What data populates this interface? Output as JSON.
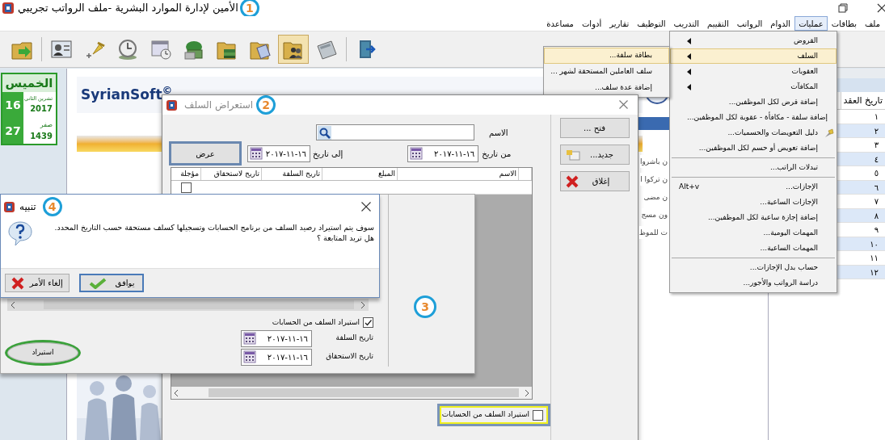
{
  "window": {
    "title": "الأمين لإدارة الموارد البشرية -ملف الرواتب تجريبي",
    "annotation": "1"
  },
  "menu_bar": [
    {
      "label": "ملف",
      "selected": false
    },
    {
      "label": "بطاقات",
      "selected": false
    },
    {
      "label": "عمليات",
      "selected": true
    },
    {
      "label": "الدوام",
      "selected": false
    },
    {
      "label": "الرواتب",
      "selected": false
    },
    {
      "label": "التقييم",
      "selected": false
    },
    {
      "label": "التدريب",
      "selected": false
    },
    {
      "label": "التوظيف",
      "selected": false
    },
    {
      "label": "تقارير",
      "selected": false
    },
    {
      "label": "أدوات",
      "selected": false
    },
    {
      "label": "مساعدة",
      "selected": false
    }
  ],
  "toolbar": [
    {
      "selected": false
    },
    {
      "selected": false
    },
    {
      "selected": false
    },
    {
      "selected": false
    },
    {
      "selected": false
    },
    {
      "selected": false
    },
    {
      "selected": false
    },
    {
      "selected": false
    },
    {
      "selected": true
    },
    {
      "selected": false
    },
    {
      "selected": false
    }
  ],
  "calendar": {
    "weekday": "الخميس",
    "day": "16",
    "month": "تشرين الثاني",
    "year": "2017",
    "hijri_day": "27",
    "hijri_month": "صفر",
    "hijri_year": "1439"
  },
  "main": {
    "logo": "SyrianSoft$^{©}$",
    "text_lines": [
      "ن باشروا",
      "ن تركوا ا",
      "ن مضى",
      "ون مسج",
      "ت للموظ"
    ]
  },
  "contracts_table": {
    "columns": [
      "تاريخ العقد"
    ],
    "rows": [
      "١",
      "٢",
      "٣",
      "٤",
      "٥",
      "٦",
      "٧",
      "٨",
      "٩",
      "١٠",
      "١١",
      "١٢"
    ]
  },
  "operations_menu": [
    {
      "kind": "submenu",
      "label": "القروض",
      "selected": false
    },
    {
      "kind": "submenu",
      "label": "السلف",
      "selected": true
    },
    {
      "kind": "submenu",
      "label": "العقوبات",
      "selected": false
    },
    {
      "kind": "submenu",
      "label": "المكافآت",
      "selected": false
    },
    {
      "kind": "item",
      "label": "إضافة قرض لكل الموظفين...",
      "selected": false
    },
    {
      "kind": "item",
      "label": "إضافة سلفة - مكافأة - عقوبة لكل الموظفين...",
      "selected": false
    },
    {
      "kind": "icon_item",
      "label": "دليل التعويضات والحسميات...",
      "selected": false
    },
    {
      "kind": "item",
      "label": "إضافة تعويض أو حسم لكل الموظفين...",
      "selected": false
    },
    {
      "kind": "separator"
    },
    {
      "kind": "item",
      "label": "تبدلات الراتب...",
      "selected": false
    },
    {
      "kind": "separator"
    },
    {
      "kind": "item",
      "label": "الإجازات...",
      "shortcut": "Alt+v",
      "selected": false
    },
    {
      "kind": "item",
      "label": "الإجازات الساعية...",
      "selected": false
    },
    {
      "kind": "item",
      "label": "إضافة إجازة ساعية لكل الموظفين...",
      "selected": false
    },
    {
      "kind": "item",
      "label": "المهمات اليومية...",
      "selected": false
    },
    {
      "kind": "item",
      "label": "المهمات الساعية...",
      "selected": false
    },
    {
      "kind": "separator"
    },
    {
      "kind": "item",
      "label": "حساب بدل الإجازات...",
      "selected": false
    },
    {
      "kind": "item",
      "label": "دراسة الرواتب والأجور...",
      "selected": false
    }
  ],
  "advances_submenu": [
    {
      "label": "بطاقة سلفة...",
      "selected": true
    },
    {
      "label": "سلف العاملين المستحقة لشهر ...",
      "selected": false
    },
    {
      "label": "إضافة عدة سلف...",
      "selected": false
    }
  ],
  "advances_dialog": {
    "title": "استعراض السلف",
    "annotation": "2",
    "name_label": "الاسم",
    "from_label": "من تاريخ",
    "from_date": "١٦-١١-٢٠١٧",
    "to_label": "إلى تاريخ",
    "to_date": "١٦-١١-٢٠١٧",
    "show_button": {
      "label": "عرض",
      "focused": true
    },
    "grid": {
      "columns": [
        "الاسم",
        "المبلغ",
        "تاريخ السلفة",
        "تاريخ لاستحقاق",
        "مؤجلة"
      ],
      "rows": [
        {
          "deferred": false
        }
      ]
    },
    "import_checkbox": {
      "label": "استيراد السلف من الحسابات",
      "checked": false,
      "highlighted": true
    },
    "buttons": [
      {
        "kind": "open",
        "label": "فتح ..."
      },
      {
        "kind": "new",
        "label": "جديد..."
      },
      {
        "kind": "close",
        "label": "إغلاق"
      }
    ]
  },
  "import_panel": {
    "annotation": "3",
    "checkbox": {
      "label": "استيراد السلف من الحسابات",
      "checked": true
    },
    "advance_date_label": "تاريخ السلفة",
    "advance_date": "١٦-١١-٢٠١٧",
    "due_date_label": "تاريخ الاستحقاق",
    "due_date": "١٦-١١-٢٠١٧",
    "import_button": {
      "label": "استيراد",
      "circled": true
    }
  },
  "alert": {
    "title": "تنبيه",
    "annotation": "4",
    "message_lines": [
      "سوف يتم استيراد رصيد السلف من برنامج الحسابات وتسجيلها كسلف مستحقة حسب التاريخ المحدد.",
      "هل تريد المتابعة ؟"
    ],
    "buttons": [
      {
        "kind": "ok",
        "label": "يوافق",
        "default": true
      },
      {
        "kind": "cancel",
        "label": "إلغاء الأمر",
        "default": false
      }
    ]
  }
}
